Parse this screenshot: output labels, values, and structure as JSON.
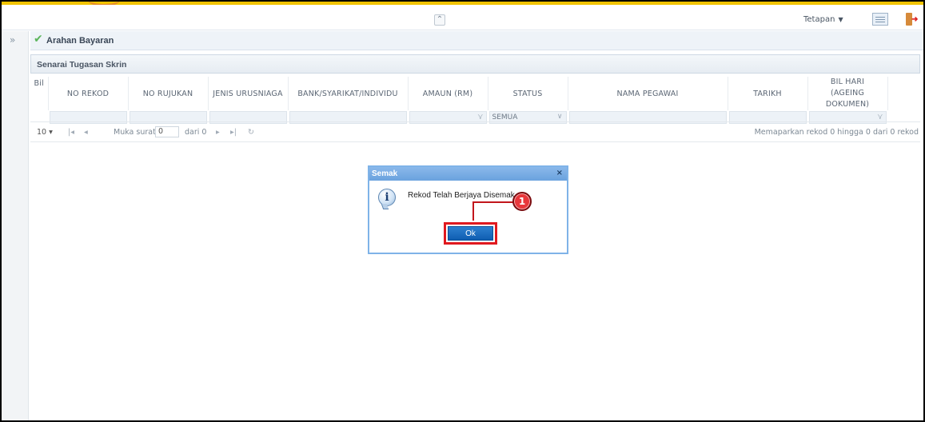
{
  "header": {
    "collapse_icon": "double-chevron-up-icon",
    "settings_label": "Tetapan",
    "grid_view_icon": "grid-view-icon",
    "logout_icon": "logout-icon"
  },
  "breadcrumb": {
    "expand_icon": "double-chevron-right-icon",
    "check_icon": "check-icon",
    "label": "Arahan Bayaran"
  },
  "panel": {
    "title": "Senarai Tugasan Skrin"
  },
  "table": {
    "columns": [
      "Bil",
      "NO REKOD",
      "NO RUJUKAN",
      "JENIS URUSNIAGA",
      "BANK/SYARIKAT/INDIVIDU",
      "AMAUN (RM)",
      "STATUS",
      "NAMA PEGAWAI",
      "TARIKH",
      "BIL HARI",
      "(AGEING DOKUMEN)"
    ],
    "status_filter_value": "SEMUA"
  },
  "pager": {
    "page_size": "10",
    "page_label": "Muka surat",
    "page_value": "0",
    "of_label": "dari 0",
    "info": "Memaparkan rekod 0 hingga 0 dari 0 rekod"
  },
  "dialog": {
    "title": "Semak",
    "close": "×",
    "message": "Rekod Telah Berjaya Disemak",
    "ok_label": "Ok",
    "icon": "info-icon"
  },
  "callout": {
    "number": "1",
    "color": "#e0191f"
  }
}
